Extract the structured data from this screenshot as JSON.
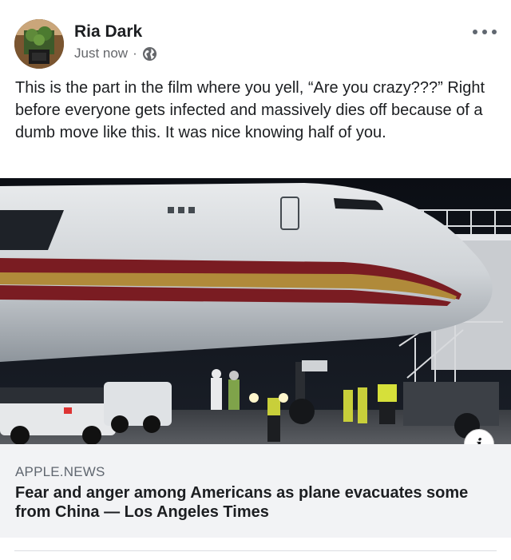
{
  "post": {
    "author": "Ria Dark",
    "timestamp": "Just now",
    "separator": "·",
    "privacy_icon": "globe-icon",
    "more_icon": "more-options-icon",
    "text": "This is the part in the film where you yell, “Are you crazy???” Right before everyone gets infected and massively dies off because of a dumb move like this. It was nice knowing half of you."
  },
  "link_preview": {
    "image_description_icon": "info-icon",
    "info_label": "i",
    "source": "APPLE.NEWS",
    "headline": "Fear and anger among Americans as plane evacuates some from China — Los Angeles Times"
  },
  "colors": {
    "text_primary": "#1c1e21",
    "text_secondary": "#65676b",
    "link_box_bg": "#f2f3f5",
    "plane_stripe": "#7a1c22",
    "plane_gold": "#b08a3a"
  }
}
